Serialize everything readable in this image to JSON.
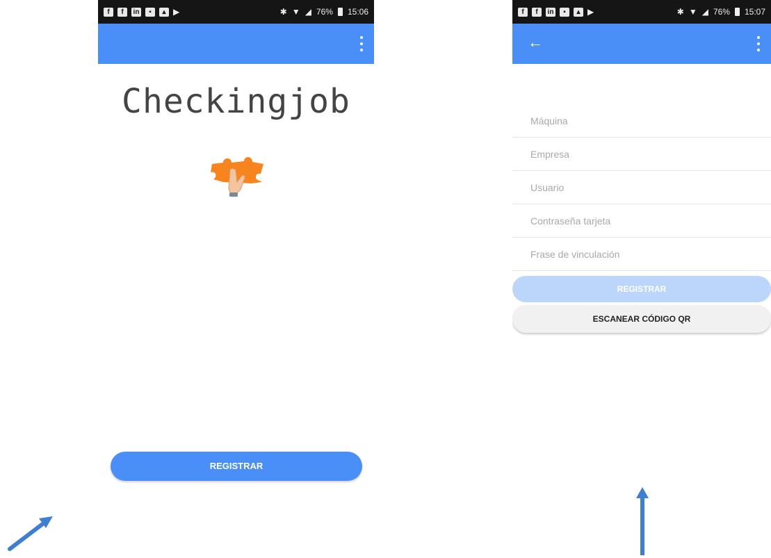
{
  "screen_left": {
    "status_bar": {
      "notification_icons": [
        "facebook-icon",
        "facebook-icon",
        "linkedin-icon",
        "gallery-icon",
        "photo-icon",
        "play-store-icon"
      ],
      "battery": "76%",
      "time": "15:06"
    },
    "title": "Checkingjob",
    "logo": "hand-holding-puzzle-logo",
    "register_label": "REGISTRAR"
  },
  "screen_right": {
    "status_bar": {
      "notification_icons": [
        "facebook-icon",
        "facebook-icon",
        "linkedin-icon",
        "gallery-icon",
        "photo-icon",
        "play-store-icon"
      ],
      "battery": "76%",
      "time": "15:07"
    },
    "fields": {
      "machine": "Máquina",
      "company": "Empresa",
      "user": "Usuario",
      "card_password": "Contraseña tarjeta",
      "link_phrase": "Frase de vinculación"
    },
    "register_label": "REGISTRAR",
    "scan_qr_label": "ESCANEAR CÓDIGO QR"
  },
  "colors": {
    "primary": "#4a8ff7",
    "primary_disabled": "#bcd6fb",
    "status_bar": "#151515",
    "logo_orange": "#f7841e",
    "annotation_arrow": "#3f7fd0"
  }
}
